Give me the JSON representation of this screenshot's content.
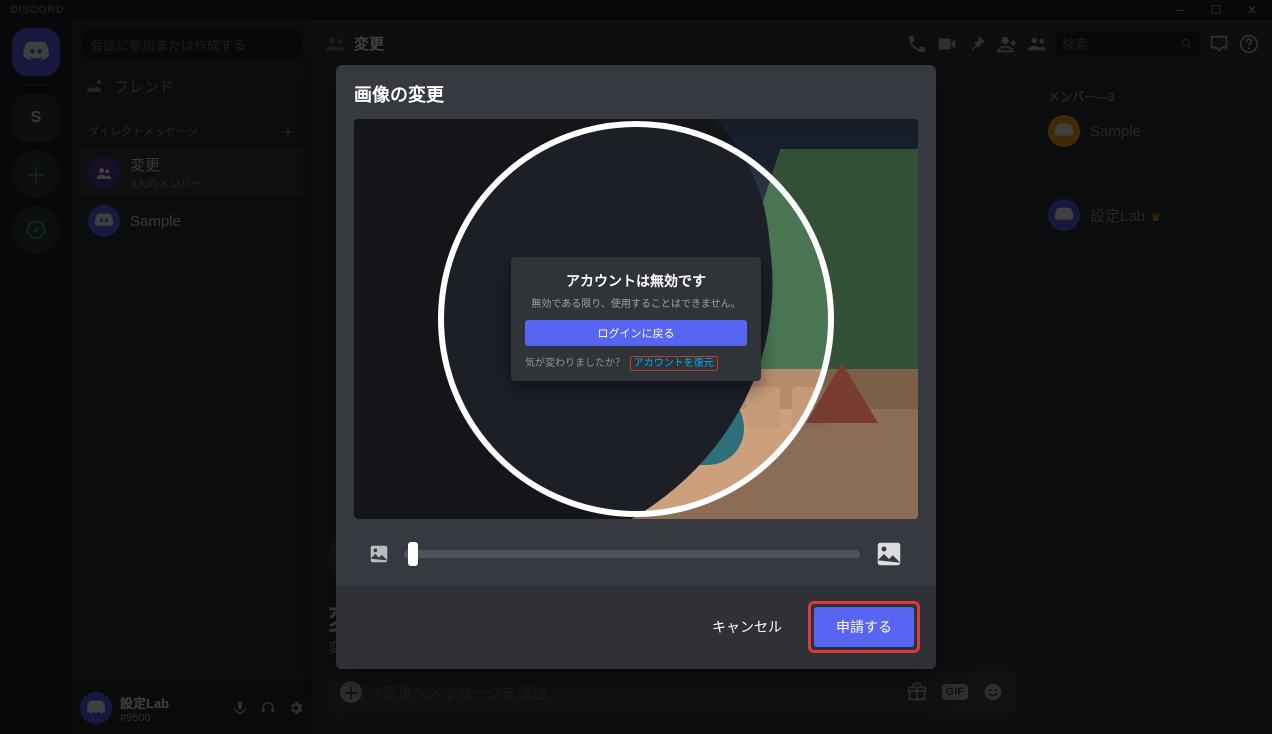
{
  "titlebar": {
    "wordmark": "DISCORD"
  },
  "rail": {
    "server_letter": "S"
  },
  "dm": {
    "find_placeholder": "会話に参加または作成する",
    "friends_label": "フレンド",
    "section_header": "ダイレクトメッセージ",
    "items": [
      {
        "name": "変更",
        "sub": "3人のメンバー"
      },
      {
        "name": "Sample",
        "sub": ""
      }
    ]
  },
  "userfoot": {
    "name": "設定Lab",
    "tag": "#9500"
  },
  "channel": {
    "name": "変更",
    "search_placeholder": "検索",
    "welcome_title": "変",
    "welcome_sub": "変",
    "composer_placeholder": "#変更へメッセージを送信",
    "gif_label": "GIF"
  },
  "members": {
    "header": "メンバー—3",
    "rows": [
      {
        "name": "Sample"
      },
      {
        "name": "設定Lab"
      }
    ]
  },
  "modal": {
    "title": "画像の変更",
    "inner": {
      "title": "アカウントは無効です",
      "sub": "無効である限り、使用することはできません。",
      "button": "ログインに戻る",
      "changed_mind": "気が変わりましたか？",
      "restore": "アカウントを復元"
    },
    "cancel": "キャンセル",
    "apply": "申請する"
  }
}
